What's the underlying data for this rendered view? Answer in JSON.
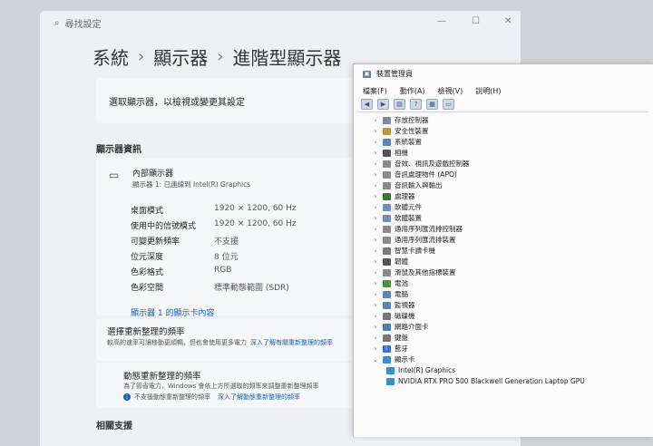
{
  "settings": {
    "search_placeholder": "尋找設定",
    "breadcrumb": [
      "系統",
      "顯示器",
      "進階型顯示器"
    ],
    "select_display": "選取顯示器，以檢視或變更其設定",
    "display_info_title": "顯示器資訊",
    "monitor_name": "內部顯示器",
    "monitor_sub": "顯示器 1: 已連線到 Intel(R) Graphics",
    "props": [
      {
        "k": "桌面模式",
        "v": "1920 × 1200, 60 Hz"
      },
      {
        "k": "使用中的信號模式",
        "v": "1920 × 1200, 60 Hz"
      },
      {
        "k": "可變更新頻率",
        "v": "不支援"
      },
      {
        "k": "位元深度",
        "v": "8 位元"
      },
      {
        "k": "色彩格式",
        "v": "RGB"
      },
      {
        "k": "色彩空間",
        "v": "標準動態範圍 (SDR)"
      }
    ],
    "adapter_link": "顯示器 1 的顯示卡內容",
    "refresh_title": "選擇重新整理的頻率",
    "refresh_desc": "較高的速率可讓移動更順暢，但也會使用更多電力",
    "refresh_link": "深入了解有關重新整理的頻率",
    "dyn_title": "動態重新整理的頻率",
    "dyn_desc": "為了節省電力，Windows 會依上方所選取的頻率來調整重新整理頻率",
    "dyn_warn": "不支援動態重新整理的頻率",
    "dyn_link": "深入了解動態重新整理的頻率",
    "related_title": "相關支援"
  },
  "devmgr": {
    "title": "裝置管理員",
    "menu": [
      "檔案(F)",
      "動作(A)",
      "檢視(V)",
      "說明(H)"
    ],
    "categories": [
      "存放控制器",
      "安全性裝置",
      "系統裝置",
      "相機",
      "音效、視訊及遊戲控制器",
      "音訊處理物件 (APO)",
      "音訊輸入與輸出",
      "處理器",
      "軟體元件",
      "軟體裝置",
      "通用序列匯流排控制器",
      "通用序列匯流排裝置",
      "智慧卡讀卡機",
      "韌體",
      "滑鼠及其他指標裝置",
      "電池",
      "電腦",
      "監視器",
      "磁碟機",
      "網路介面卡",
      "鍵盤",
      "藍牙",
      "顯示卡"
    ],
    "display_adapters": [
      "Intel(R) Graphics",
      "NVIDIA RTX PRO 500 Blackwell Generation Laptop GPU"
    ]
  }
}
